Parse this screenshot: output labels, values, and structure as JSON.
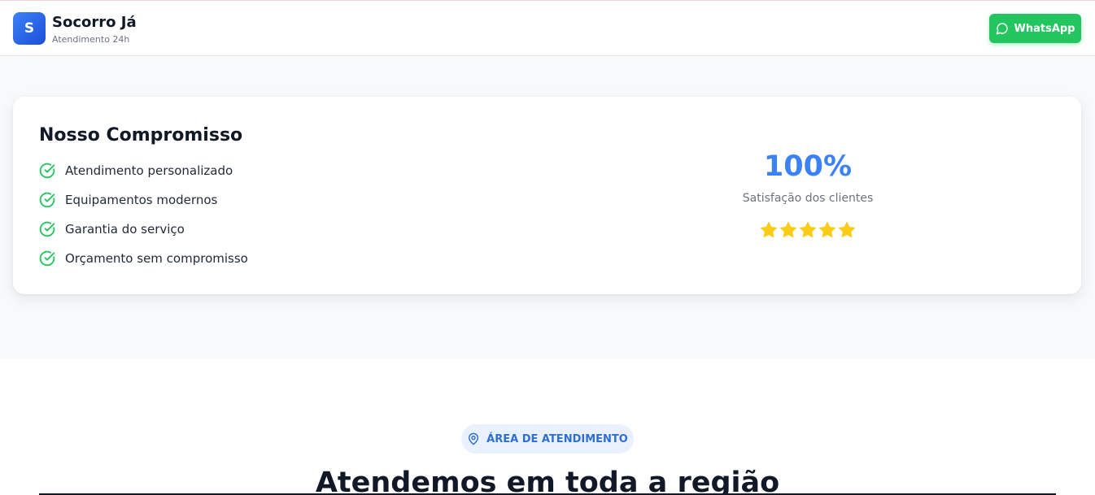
{
  "header": {
    "logo_letter": "S",
    "brand_name": "Socorro Já",
    "tagline": "Atendimento 24h",
    "whatsapp_label": "WhatsApp"
  },
  "commitment": {
    "title": "Nosso Compromisso",
    "features": [
      "Atendimento personalizado",
      "Equipamentos modernos",
      "Garantia do serviço",
      "Orçamento sem compromisso"
    ],
    "stat_value": "100%",
    "stat_label": "Satisfação dos clientes",
    "rating": 5
  },
  "area": {
    "badge": "ÁREA DE ATENDIMENTO",
    "title": "Atendemos em toda a região"
  },
  "colors": {
    "accent": "#3b82f6",
    "whatsapp": "#22c55e",
    "check": "#22c55e",
    "star": "#facc15"
  }
}
